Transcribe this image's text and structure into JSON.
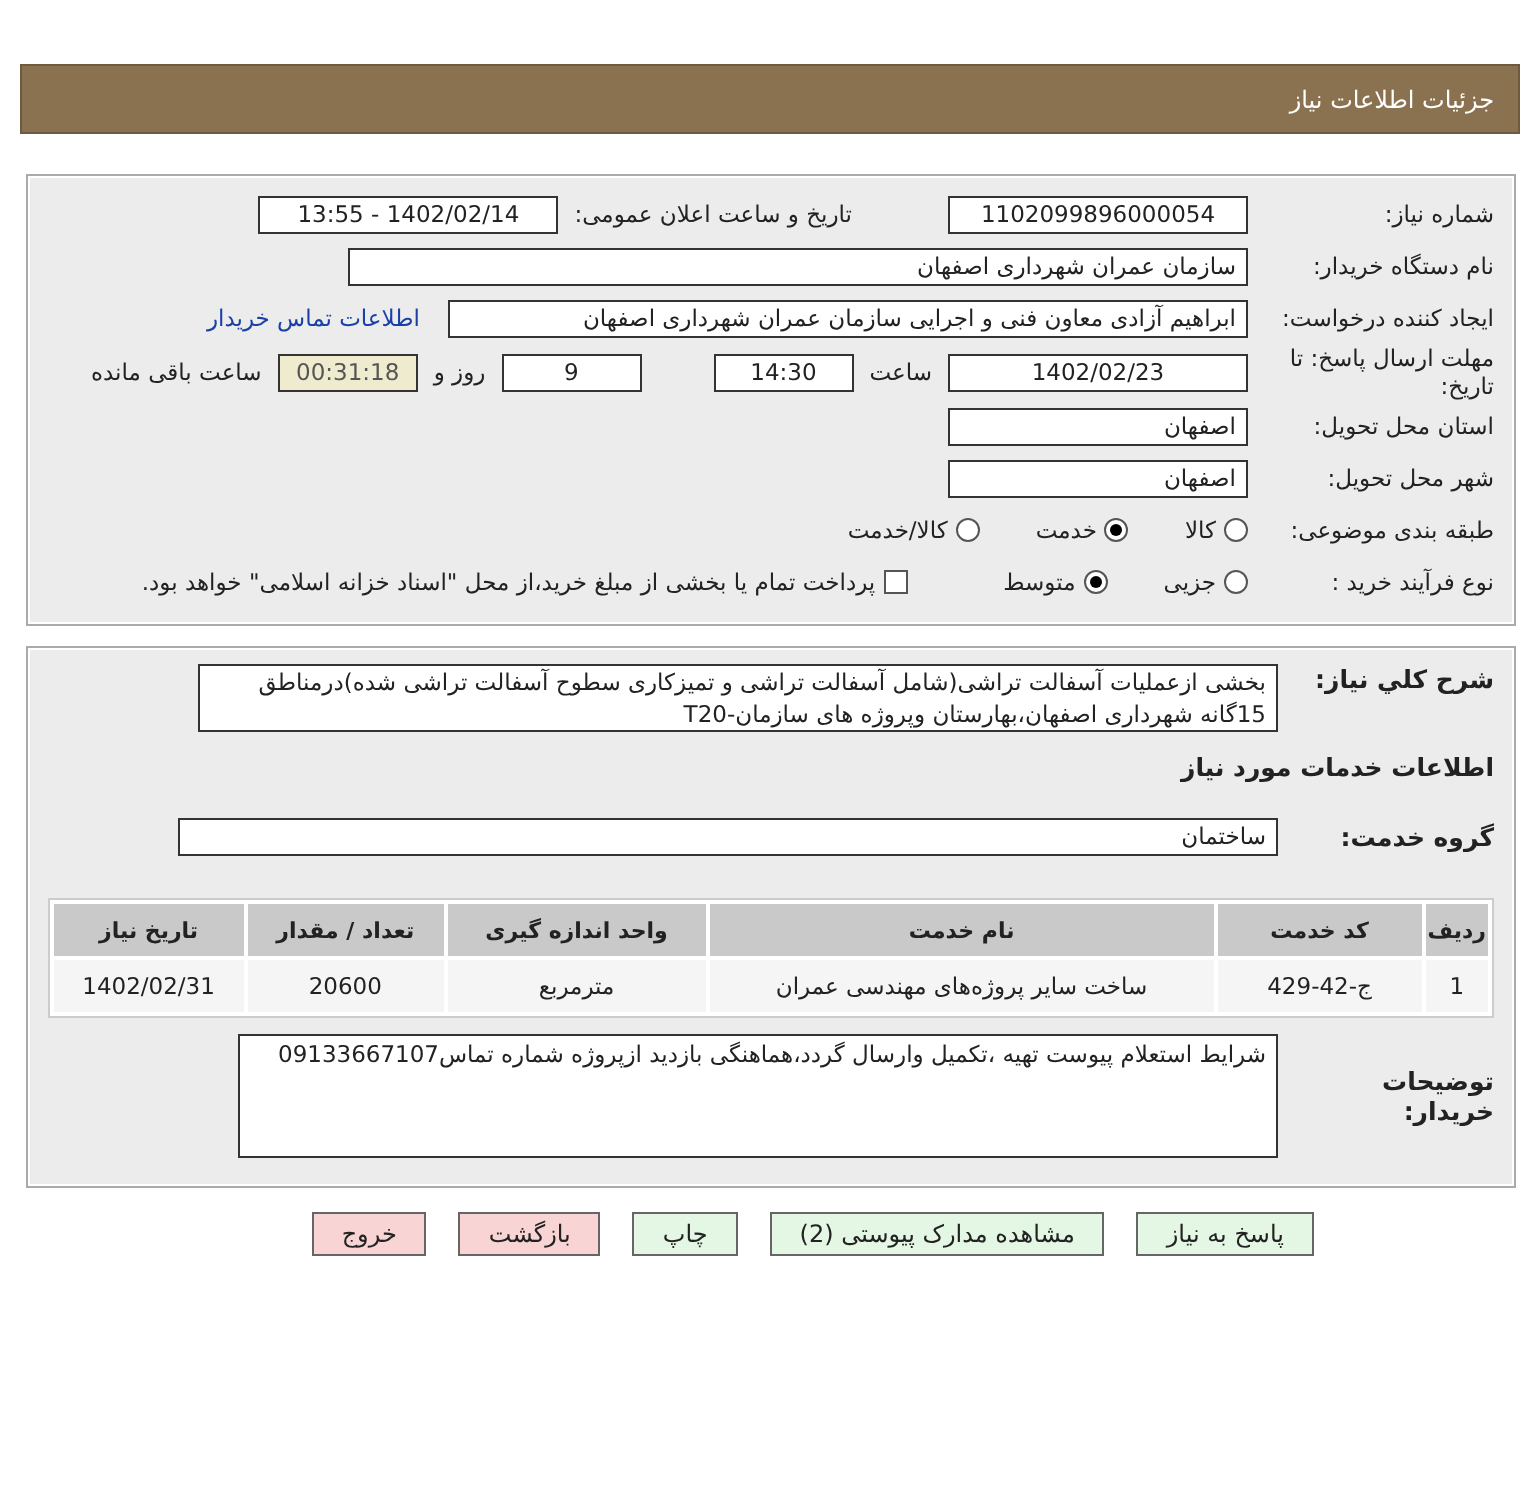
{
  "header": {
    "title": "جزئیات اطلاعات نیاز"
  },
  "need_number": {
    "label": "شماره نیاز:",
    "value": "1102099896000054"
  },
  "announce": {
    "label": "تاریخ و ساعت اعلان عمومی:",
    "value": "1402/02/14 - 13:55"
  },
  "buyer_org": {
    "label": "نام دستگاه خریدار:",
    "value": "سازمان عمران شهرداری اصفهان"
  },
  "requester": {
    "label": "ایجاد کننده درخواست:",
    "value": "ابراهیم آزادی معاون فنی و اجرایی سازمان عمران شهرداری اصفهان",
    "link": "اطلاعات تماس خریدار"
  },
  "deadline": {
    "label": "مهلت ارسال پاسخ: تا تاریخ:",
    "date": "1402/02/23",
    "time_label": "ساعت",
    "time": "14:30",
    "days": "9",
    "days_label": "روز و",
    "remaining": "00:31:18",
    "remaining_label": "ساعت باقی مانده"
  },
  "province": {
    "label": "استان محل تحویل:",
    "value": "اصفهان"
  },
  "city": {
    "label": "شهر محل تحویل:",
    "value": "اصفهان"
  },
  "category": {
    "label": "طبقه بندی موضوعی:",
    "options": [
      {
        "label": "کالا",
        "selected": false
      },
      {
        "label": "خدمت",
        "selected": true
      },
      {
        "label": "کالا/خدمت",
        "selected": false
      }
    ]
  },
  "process": {
    "label": "نوع فرآیند خرید :",
    "options": [
      {
        "label": "جزیی",
        "selected": false
      },
      {
        "label": "متوسط",
        "selected": true
      }
    ],
    "payment": {
      "label": "پرداخت تمام یا بخشی از مبلغ خرید،از محل \"اسناد خزانه اسلامی\" خواهد بود.",
      "checked": false
    }
  },
  "description": {
    "label": "شرح کلي نياز:",
    "value": "بخشی ازعملیات آسفالت تراشی(شامل آسفالت تراشی و تمیزکاری سطوح آسفالت تراشی شده)درمناطق 15گانه شهرداری اصفهان،بهارستان وپروژه های سازمان-T20"
  },
  "services_heading": "اطلاعات خدمات مورد نیاز",
  "service_group": {
    "label": "گروه خدمت:",
    "value": "ساختمان"
  },
  "table": {
    "columns": [
      "ردیف",
      "کد خدمت",
      "نام خدمت",
      "واحد اندازه گیری",
      "تعداد / مقدار",
      "تاریخ نیاز"
    ],
    "rows": [
      [
        "1",
        "ج-42-429",
        "ساخت سایر پروژه‌های مهندسی عمران",
        "مترمربع",
        "20600",
        "1402/02/31"
      ]
    ]
  },
  "buyer_notes": {
    "label": "توضیحات خریدار:",
    "value": "شرایط استعلام پیوست تهیه ،تکمیل وارسال گردد،هماهنگی بازدید ازپروژه شماره تماس09133667107"
  },
  "buttons": [
    {
      "label": "پاسخ به نیاز",
      "kind": "action"
    },
    {
      "label": "مشاهده مدارک پیوستی (2)",
      "kind": "action"
    },
    {
      "label": "چاپ",
      "kind": "action"
    },
    {
      "label": "بازگشت",
      "kind": "exit"
    },
    {
      "label": "خروج",
      "kind": "exit"
    }
  ]
}
